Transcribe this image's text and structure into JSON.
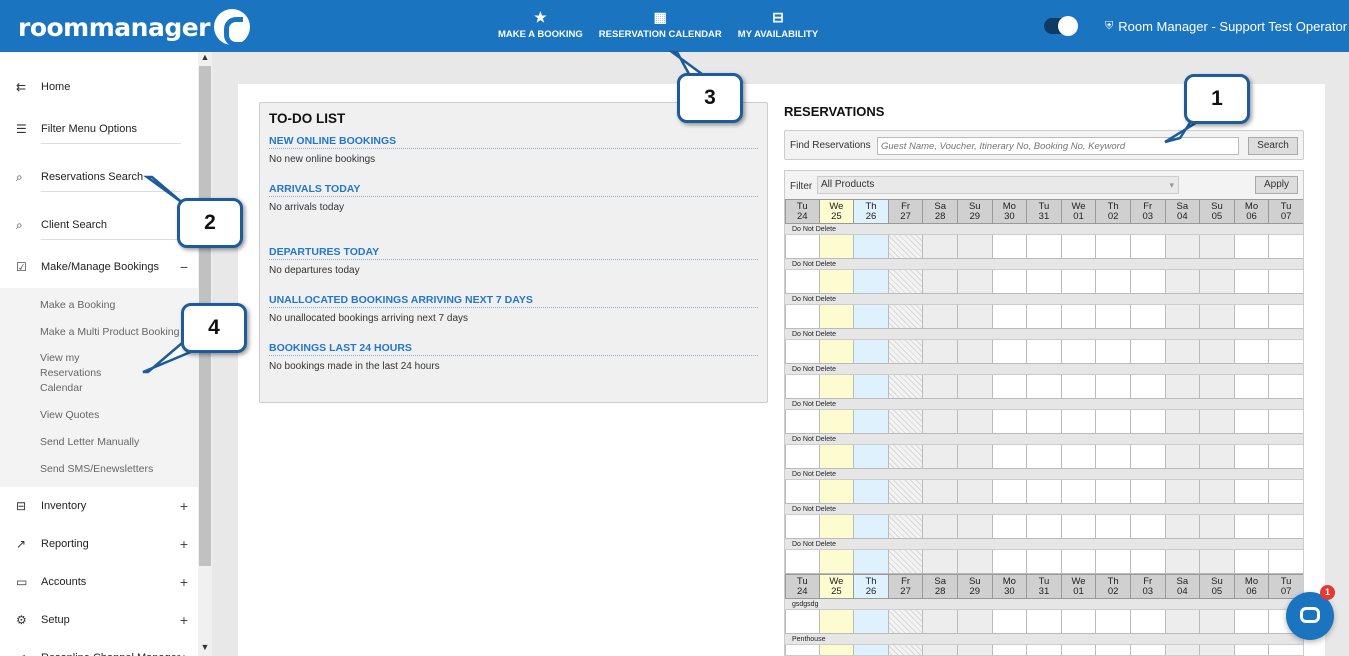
{
  "app": {
    "logo": "roommanager",
    "user": "Room Manager - Support Test Operator"
  },
  "topnav": [
    {
      "label": "MAKE A BOOKING",
      "icon": "★"
    },
    {
      "label": "RESERVATION CALENDAR",
      "icon": "▦"
    },
    {
      "label": "MY AVAILABILITY",
      "icon": "⊟"
    }
  ],
  "sidebar": {
    "items": [
      {
        "label": "Home",
        "icon": "⇇"
      },
      {
        "label": "Filter Menu Options",
        "icon": "☰"
      },
      {
        "label": "Reservations Search",
        "icon": "⌕"
      },
      {
        "label": "Client Search",
        "icon": "⌕"
      },
      {
        "label": "Make/Manage Bookings",
        "icon": "☑",
        "pm": "−"
      }
    ],
    "sub": [
      "Make a Booking",
      "Make a Multi Product Booking",
      "View my Reservations Calendar",
      "View Quotes",
      "Send Letter Manually",
      "Send SMS/Enewsletters"
    ],
    "items2": [
      {
        "label": "Inventory",
        "icon": "⊟",
        "pm": "+"
      },
      {
        "label": "Reporting",
        "icon": "↗",
        "pm": "+"
      },
      {
        "label": "Accounts",
        "icon": "▭",
        "pm": "+"
      },
      {
        "label": "Setup",
        "icon": "⚙",
        "pm": "+"
      },
      {
        "label": "Resonline Channel Manager",
        "icon": "⋖",
        "pm": "+"
      }
    ]
  },
  "todo": {
    "title": "TO-DO LIST",
    "sections": [
      {
        "head": "NEW ONLINE BOOKINGS",
        "text": "No new online bookings"
      },
      {
        "head": "ARRIVALS TODAY",
        "text": "No arrivals today"
      },
      {
        "head": "DEPARTURES TODAY",
        "text": "No departures today"
      },
      {
        "head": "UNALLOCATED BOOKINGS ARRIVING NEXT 7 DAYS",
        "text": "No unallocated bookings arriving next 7 days"
      },
      {
        "head": "BOOKINGS LAST 24 HOURS",
        "text": "No bookings made in the last 24 hours"
      }
    ]
  },
  "reservations": {
    "title": "RESERVATIONS",
    "find_label": "Find Reservations",
    "find_placeholder": "Guest Name, Voucher, Itinerary No, Booking No, Keyword",
    "search_label": "Search",
    "filter_label": "Filter",
    "filter_value": "All Products",
    "apply_label": "Apply",
    "days": [
      {
        "d": "Tu",
        "n": "24"
      },
      {
        "d": "We",
        "n": "25"
      },
      {
        "d": "Th",
        "n": "26"
      },
      {
        "d": "Fr",
        "n": "27"
      },
      {
        "d": "Sa",
        "n": "28"
      },
      {
        "d": "Su",
        "n": "29"
      },
      {
        "d": "Mo",
        "n": "30"
      },
      {
        "d": "Tu",
        "n": "31"
      },
      {
        "d": "We",
        "n": "01"
      },
      {
        "d": "Th",
        "n": "02"
      },
      {
        "d": "Fr",
        "n": "03"
      },
      {
        "d": "Sa",
        "n": "04"
      },
      {
        "d": "Su",
        "n": "05"
      },
      {
        "d": "Mo",
        "n": "06"
      },
      {
        "d": "Tu",
        "n": "07"
      }
    ],
    "rows1": [
      "Do Not Delete",
      "Do Not Delete",
      "Do Not Delete",
      "Do Not Delete",
      "Do Not Delete",
      "Do Not Delete",
      "Do Not Delete",
      "Do Not Delete",
      "Do Not Delete",
      "Do Not Delete"
    ],
    "rows2": [
      "gsdgsdg",
      "Penthouse"
    ]
  },
  "callouts": [
    "1",
    "2",
    "3",
    "4"
  ],
  "chat_badge": "1",
  "colors": {
    "primary": "#1b74c0",
    "link": "#2277cc"
  }
}
